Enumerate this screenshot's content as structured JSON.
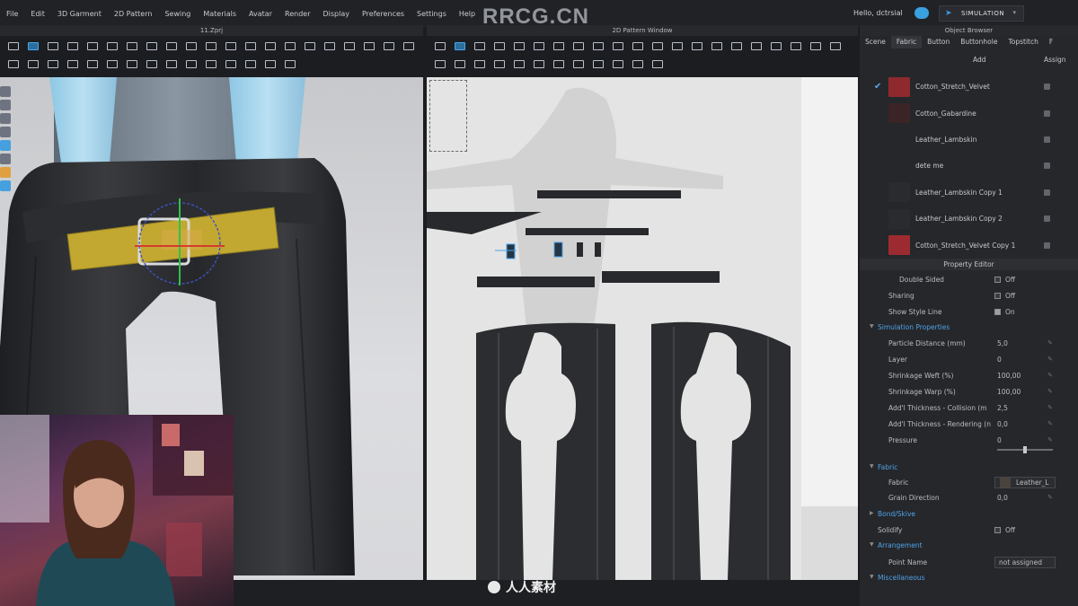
{
  "menubar": {
    "items": [
      "File",
      "Edit",
      "3D Garment",
      "2D Pattern",
      "Sewing",
      "Materials",
      "Avatar",
      "Render",
      "Display",
      "Preferences",
      "Settings",
      "Help"
    ],
    "brand": "RRCG.CN",
    "hello": "Hello, dctrsial",
    "simulation_label": "SIMULATION"
  },
  "viewport3d": {
    "title": "11.Zprj"
  },
  "viewport2d": {
    "title": "2D Pattern Window"
  },
  "object_browser": {
    "title": "Object Browser",
    "tabs": [
      "Scene",
      "Fabric",
      "Button",
      "Buttonhole",
      "Topstitch",
      "F"
    ],
    "active_tab": "Fabric",
    "add_label": "Add",
    "assign_label": "Assign",
    "fabrics": [
      {
        "name": "Cotton_Stretch_Velvet",
        "color": "#8e2a2e",
        "selected": true
      },
      {
        "name": "Cotton_Gabardine",
        "color": "#3a2426",
        "selected": false
      },
      {
        "name": "Leather_Lambskin",
        "color": "#26272a",
        "selected": false
      },
      {
        "name": "dete me",
        "color": "#26272a",
        "selected": false
      },
      {
        "name": "Leather_Lambskin Copy 1",
        "color": "#2a2b2e",
        "selected": false
      },
      {
        "name": "Leather_Lambskin Copy 2",
        "color": "#2a2b2e",
        "selected": false
      },
      {
        "name": "Cotton_Stretch_Velvet Copy 1",
        "color": "#9b2b30",
        "selected": false
      }
    ]
  },
  "property_editor": {
    "title": "Property Editor",
    "double_sided": {
      "label": "Double Sided",
      "value": "Off"
    },
    "sharing": {
      "label": "Sharing",
      "value": "Off"
    },
    "show_style_line": {
      "label": "Show Style Line",
      "value": "On"
    },
    "sim_section": "Simulation Properties",
    "particle_distance": {
      "label": "Particle Distance (mm)",
      "value": "5,0"
    },
    "layer": {
      "label": "Layer",
      "value": "0"
    },
    "shrinkage_weft": {
      "label": "Shrinkage Weft (%)",
      "value": "100,00"
    },
    "shrinkage_warp": {
      "label": "Shrinkage Warp (%)",
      "value": "100,00"
    },
    "thickness_collision": {
      "label": "Add'l Thickness - Collision (m",
      "value": "2,5"
    },
    "thickness_rendering": {
      "label": "Add'l Thickness - Rendering (n",
      "value": "0,0"
    },
    "pressure": {
      "label": "Pressure",
      "value": "0"
    },
    "fabric_section": "Fabric",
    "fabric": {
      "label": "Fabric",
      "value": "Leather_L"
    },
    "grain_direction": {
      "label": "Grain Direction",
      "value": "0,0"
    },
    "bond_section": "Bond/Skive",
    "solidify": {
      "label": "Solidify",
      "value": "Off"
    },
    "arrangement_section": "Arrangement",
    "point_name": {
      "label": "Point Name",
      "value": "not assigned"
    },
    "next_section": "Miscellaneous"
  },
  "footer": {
    "logo_text": "人人素材"
  },
  "colors": {
    "accent": "#4aa3ea",
    "panel": "#25272b",
    "velvet": "#8e2a2e"
  }
}
